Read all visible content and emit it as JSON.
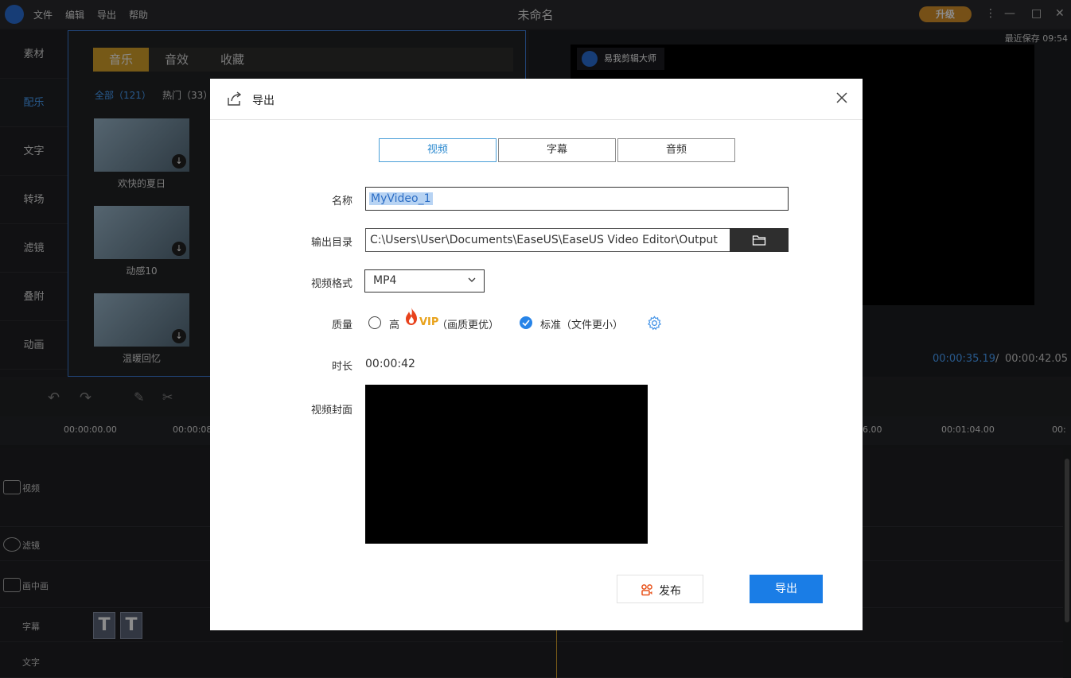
{
  "app": {
    "menu": [
      "文件",
      "编辑",
      "导出",
      "帮助"
    ],
    "window_title": "未命名",
    "upgrade_label": "升级",
    "last_saved": "最近保存 09:54"
  },
  "left_nav": {
    "items": [
      {
        "label": "素材"
      },
      {
        "label": "配乐"
      },
      {
        "label": "文字"
      },
      {
        "label": "转场"
      },
      {
        "label": "滤镜"
      },
      {
        "label": "叠附"
      },
      {
        "label": "动画"
      }
    ]
  },
  "library": {
    "tabs": [
      "音乐",
      "音效",
      "收藏"
    ],
    "filters": [
      "全部（121）",
      "热门（33）"
    ],
    "items": [
      {
        "caption": "欢快的夏日"
      },
      {
        "caption": "动感10"
      },
      {
        "caption": "温暖回忆"
      }
    ]
  },
  "preview": {
    "brand": "易我剪辑大师",
    "current_time": "00:00:35.19",
    "separator": "/",
    "total_time": "00:00:42.05"
  },
  "timeline": {
    "ruler": [
      "00:00:00.00",
      "00:00:08",
      "6.00",
      "00:01:04.00",
      "00:"
    ],
    "tracks": [
      {
        "label": "视频"
      },
      {
        "label": "滤镜"
      },
      {
        "label": "画中画"
      },
      {
        "label": "字幕"
      },
      {
        "label": "文字"
      }
    ],
    "subtitle_glyph": "T"
  },
  "dialog": {
    "title": "导出",
    "tabs": [
      {
        "label": "视频",
        "active": true
      },
      {
        "label": "字幕",
        "active": false
      },
      {
        "label": "音频",
        "active": false
      }
    ],
    "fields": {
      "name_label": "名称",
      "name_value": "MyVideo_1",
      "output_label": "输出目录",
      "output_path": "C:\\Users\\User\\Documents\\EaseUS\\EaseUS Video Editor\\Output",
      "format_label": "视频格式",
      "format_value": "MP4",
      "quality_label": "质量",
      "quality_high": "高",
      "quality_high_badge": "VIP",
      "quality_high_note": "（画质更优）",
      "quality_standard": "标准（文件更小）",
      "quality_selected": "standard",
      "duration_label": "时长",
      "duration_value": "00:00:42",
      "cover_label": "视频封面"
    },
    "buttons": {
      "publish": "发布",
      "export": "导出"
    }
  },
  "colors": {
    "accent_blue": "#1a7de6",
    "tab_active": "#2e8bd0",
    "vip": "#e8a21c",
    "upgrade": "#d8922b",
    "library_tab": "#d8a22a"
  }
}
